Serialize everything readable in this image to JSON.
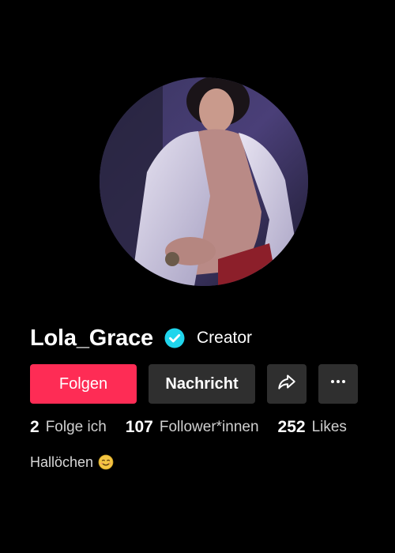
{
  "profile": {
    "username": "Lola_Grace",
    "role_label": "Creator",
    "verified_icon": "verified-check-icon",
    "avatar_icon": "profile-photo"
  },
  "actions": {
    "follow_label": "Folgen",
    "message_label": "Nachricht",
    "share_icon": "share-arrow-icon",
    "more_icon": "more-dots-icon"
  },
  "stats": [
    {
      "value": "2",
      "label": "Folge ich"
    },
    {
      "value": "107",
      "label": "Follower*innen"
    },
    {
      "value": "252",
      "label": "Likes"
    }
  ],
  "bio": {
    "text": "Hallöchen",
    "emoji_icon": "smiling-face-emoji-icon"
  },
  "colors": {
    "background": "#000000",
    "follow_button": "#fe2c55",
    "secondary_button": "#2f2f2f",
    "verified_badge": "#20d5ec"
  }
}
